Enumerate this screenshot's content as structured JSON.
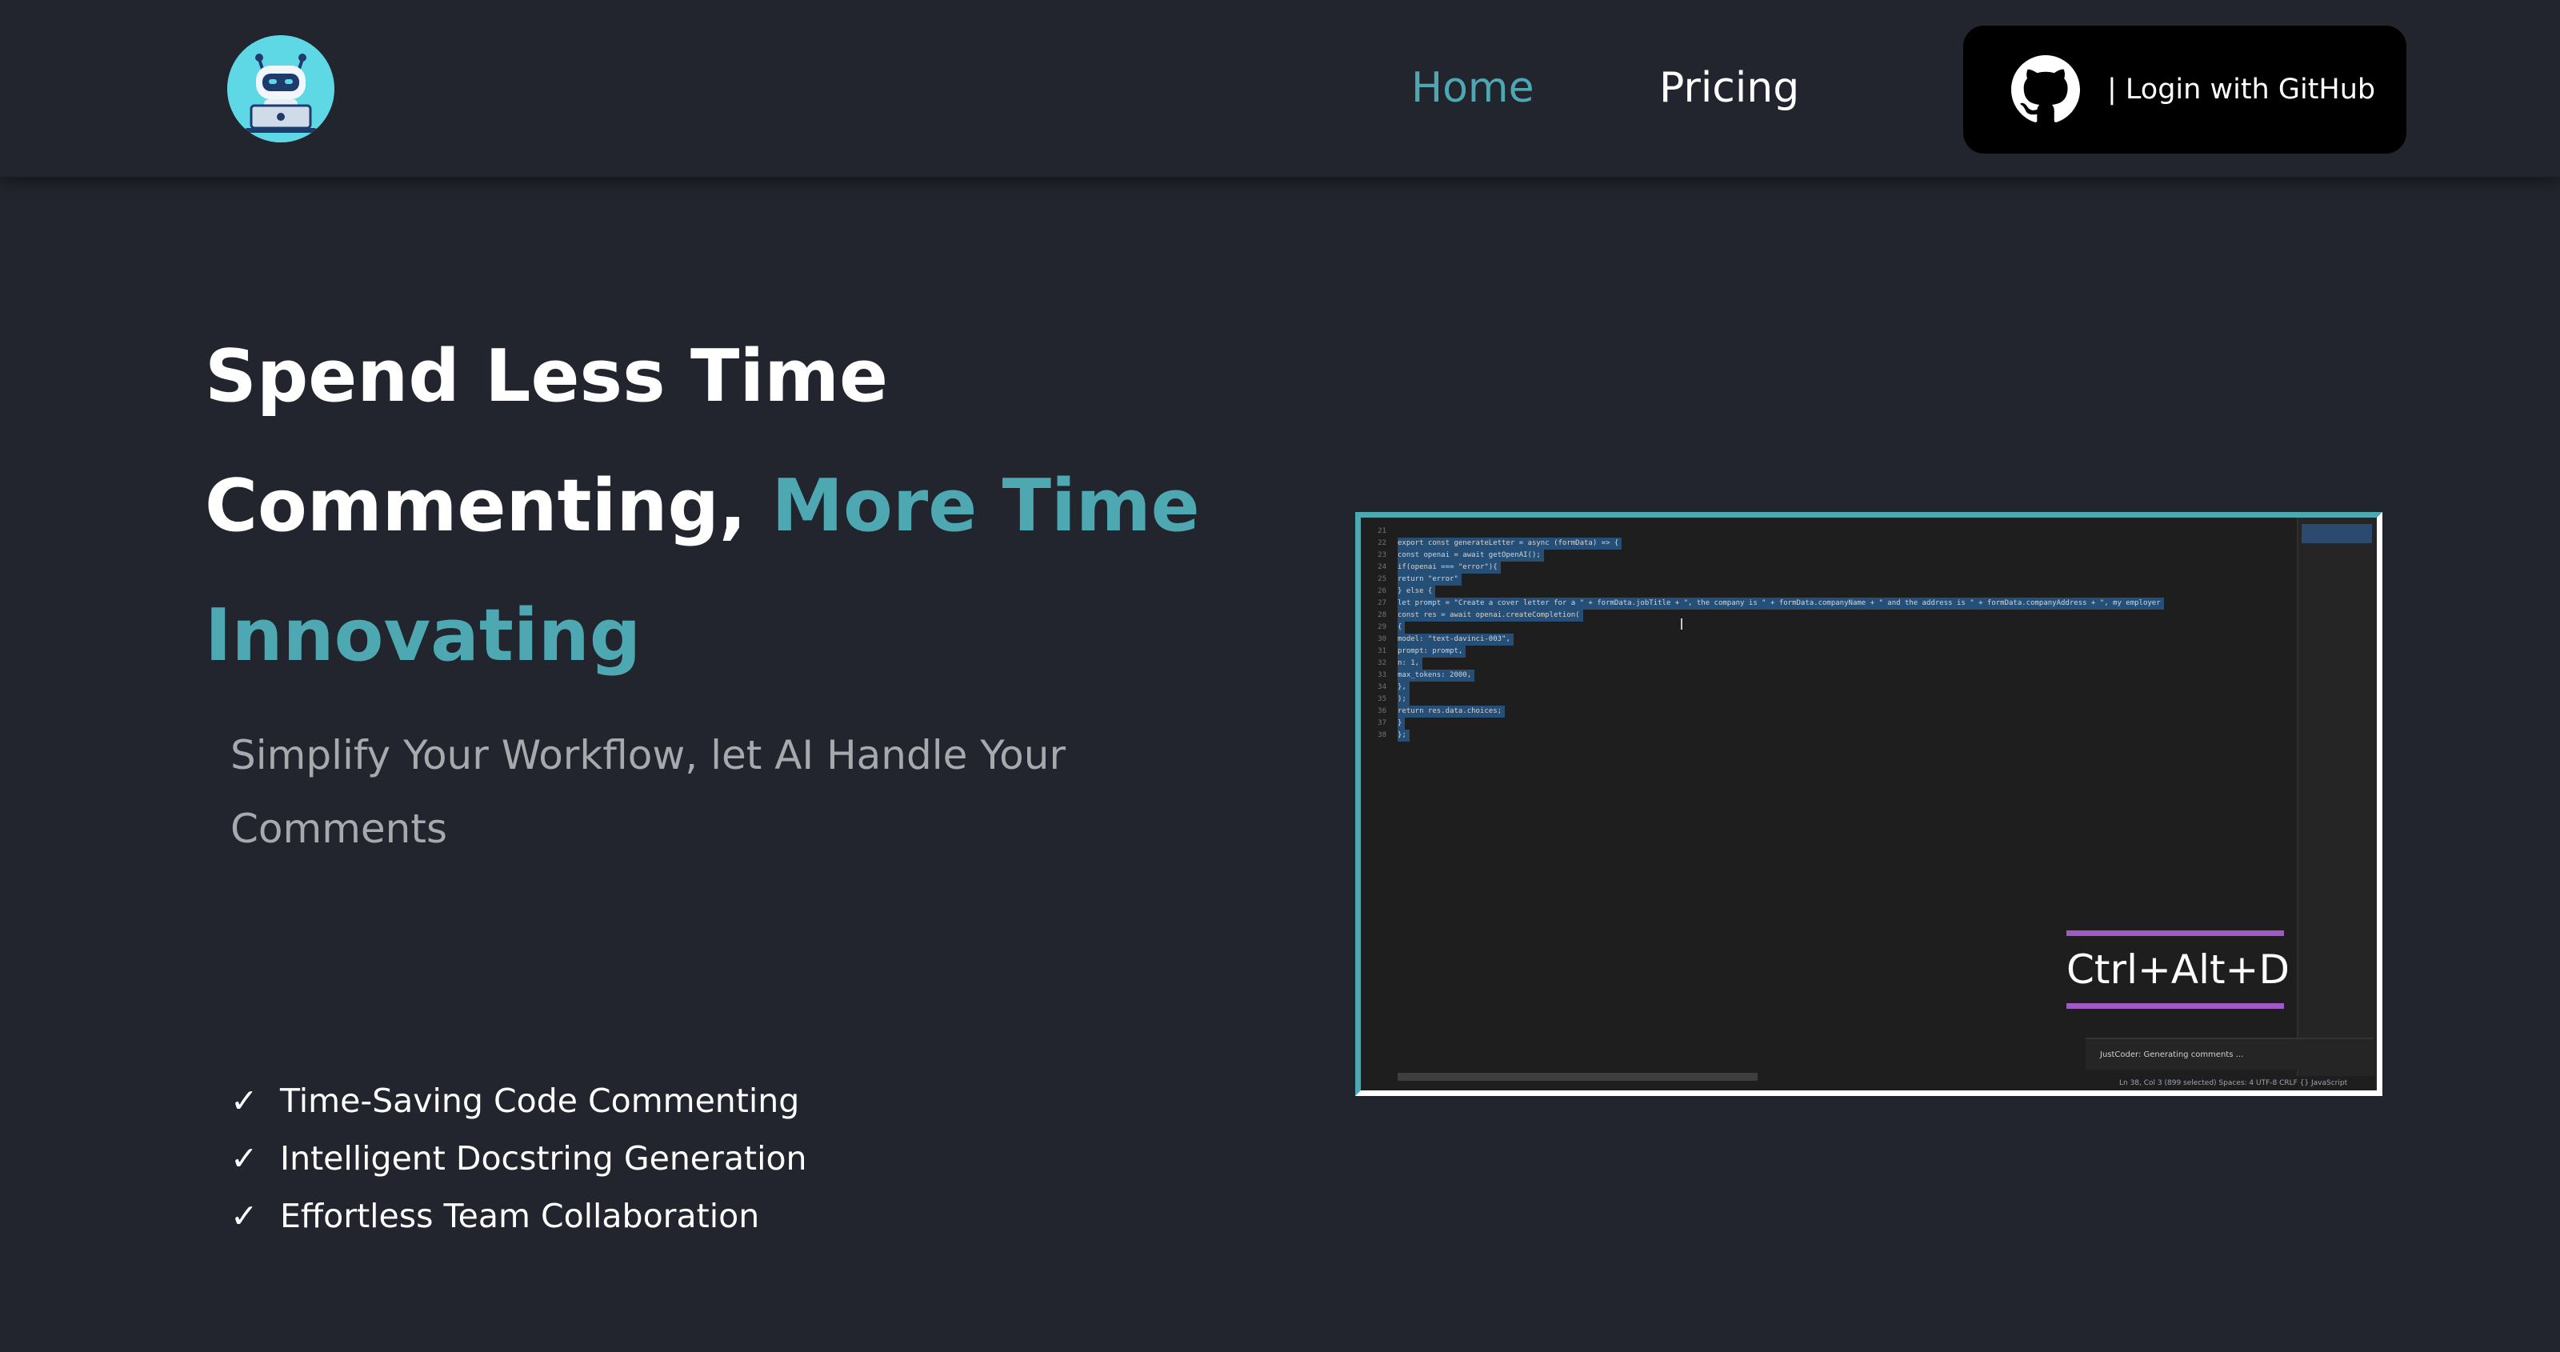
{
  "nav": {
    "home_label": "Home",
    "pricing_label": "Pricing",
    "login_label": "| Login with GitHub"
  },
  "hero": {
    "title_line1": "Spend Less Time",
    "title_line2": "Commenting,",
    "title_accent": "More Time",
    "title_line3": "Innovating",
    "subtitle": "Simplify Your Workflow, let AI Handle Your Comments"
  },
  "features": [
    {
      "check": "✓",
      "label": "Time-Saving Code Commenting"
    },
    {
      "check": "✓",
      "label": "Intelligent Docstring Generation"
    },
    {
      "check": "✓",
      "label": "Effortless Team Collaboration"
    }
  ],
  "demo": {
    "shortcut": "Ctrl+Alt+D",
    "toast": "JustCoder: Generating comments ...",
    "status": "Ln 38, Col 3 (899 selected)   Spaces: 4   UTF-8   CRLF   {} JavaScript",
    "code_lines": [
      {
        "n": "21",
        "t": ""
      },
      {
        "n": "22",
        "t": "export const generateLetter = async (formData) => {"
      },
      {
        "n": "23",
        "t": "    const openai = await getOpenAI();"
      },
      {
        "n": "24",
        "t": "    if(openai === \"error\"){"
      },
      {
        "n": "25",
        "t": "        return \"error\""
      },
      {
        "n": "26",
        "t": "    } else {"
      },
      {
        "n": "27",
        "t": "        let prompt = \"Create a cover letter for a \" + formData.jobTitle + \", the company is \" + formData.companyName + \" and the address is \" + formData.companyAddress + \", my employer"
      },
      {
        "n": "28",
        "t": "        const res = await openai.createCompletion("
      },
      {
        "n": "29",
        "t": "            {"
      },
      {
        "n": "30",
        "t": "                model: \"text-davinci-003\","
      },
      {
        "n": "31",
        "t": "                prompt: prompt,"
      },
      {
        "n": "32",
        "t": "                n: 1,"
      },
      {
        "n": "33",
        "t": "                max_tokens: 2000,"
      },
      {
        "n": "34",
        "t": "            },"
      },
      {
        "n": "35",
        "t": "        );"
      },
      {
        "n": "36",
        "t": "        return res.data.choices;"
      },
      {
        "n": "37",
        "t": "    }"
      },
      {
        "n": "38",
        "t": "};"
      }
    ]
  },
  "colors": {
    "background": "#22252d",
    "accent": "#4ea8b2",
    "muted_text": "#a7a9ad",
    "shortcut_underline": "#a259c8",
    "login_bg": "#000000"
  },
  "icons": {
    "logo": "robot-laptop-icon",
    "github": "github-icon",
    "check": "check-icon"
  }
}
